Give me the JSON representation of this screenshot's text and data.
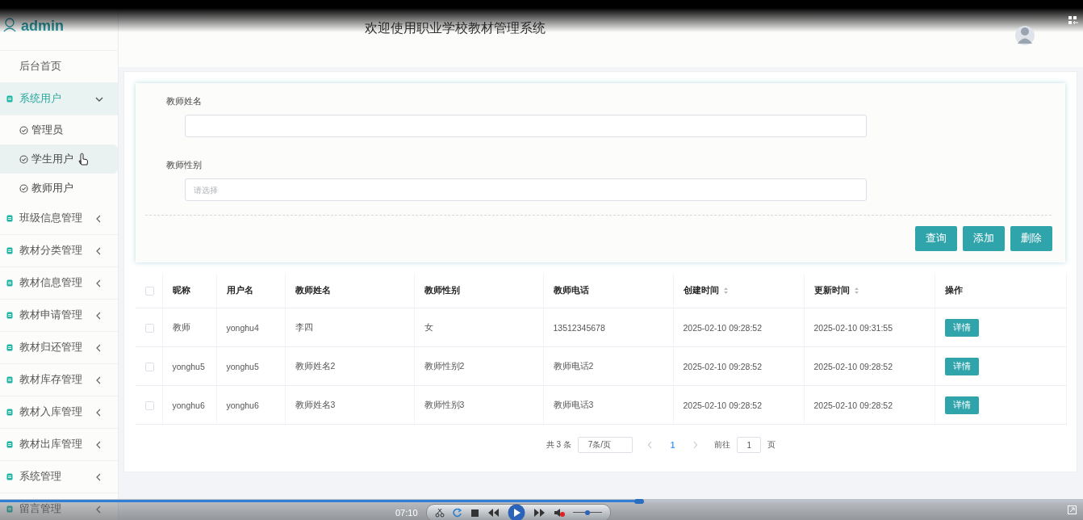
{
  "sidebar": {
    "user": "admin",
    "items": [
      {
        "label": "后台首页",
        "kind": "link"
      },
      {
        "label": "系统用户",
        "kind": "group",
        "expanded": true,
        "children": [
          {
            "label": "管理员",
            "selected": false
          },
          {
            "label": "学生用户",
            "selected": true
          },
          {
            "label": "教师用户",
            "selected": false
          }
        ]
      },
      {
        "label": "班级信息管理",
        "kind": "group",
        "expanded": false
      },
      {
        "label": "教材分类管理",
        "kind": "group",
        "expanded": false
      },
      {
        "label": "教材信息管理",
        "kind": "group",
        "expanded": false
      },
      {
        "label": "教材申请管理",
        "kind": "group",
        "expanded": false
      },
      {
        "label": "教材归还管理",
        "kind": "group",
        "expanded": false
      },
      {
        "label": "教材库存管理",
        "kind": "group",
        "expanded": false
      },
      {
        "label": "教材入库管理",
        "kind": "group",
        "expanded": false
      },
      {
        "label": "教材出库管理",
        "kind": "group",
        "expanded": false
      },
      {
        "label": "系统管理",
        "kind": "group",
        "expanded": false
      },
      {
        "label": "留言管理",
        "kind": "group",
        "expanded": false
      }
    ]
  },
  "header": {
    "title": "欢迎使用职业学校教材管理系统"
  },
  "form": {
    "fields": [
      {
        "label": "教师姓名"
      },
      {
        "label": "教师性别",
        "placeholder": "请选择"
      }
    ],
    "buttons": [
      "查询",
      "添加",
      "删除"
    ]
  },
  "table": {
    "all_checked": false,
    "columns": [
      {
        "label": "昵称",
        "sortable": false
      },
      {
        "label": "用户名",
        "sortable": false
      },
      {
        "label": "教师姓名",
        "sortable": false
      },
      {
        "label": "教师性别",
        "sortable": false
      },
      {
        "label": "教师电话",
        "sortable": false
      },
      {
        "label": "创建时间",
        "sortable": true
      },
      {
        "label": "更新时间",
        "sortable": true
      },
      {
        "label": "操作",
        "sortable": false
      }
    ],
    "rows": [
      {
        "checked": false,
        "cells": [
          "教师",
          "yonghu4",
          "李四",
          "女",
          "13512345678",
          "2025-02-10 09:28:52",
          "2025-02-10 09:31:55"
        ],
        "action": "详情"
      },
      {
        "checked": false,
        "cells": [
          "yonghu5",
          "yonghu5",
          "教师姓名2",
          "教师性别2",
          "教师电话2",
          "2025-02-10 09:28:52",
          "2025-02-10 09:28:52"
        ],
        "action": "详情"
      },
      {
        "checked": false,
        "cells": [
          "yonghu6",
          "yonghu6",
          "教师姓名3",
          "教师性别3",
          "教师电话3",
          "2025-02-10 09:28:52",
          "2025-02-10 09:28:52"
        ],
        "action": "详情"
      }
    ]
  },
  "pagination": {
    "total": "共 3 条",
    "page_size": "7条/页",
    "pages": [
      {
        "label": "1",
        "selected": true
      }
    ],
    "goto_label": "前往",
    "goto_value": "1",
    "page_unit": "页"
  },
  "player": {
    "time": "07:10",
    "level": 0.59,
    "volume": {
      "level": 0.5
    }
  }
}
